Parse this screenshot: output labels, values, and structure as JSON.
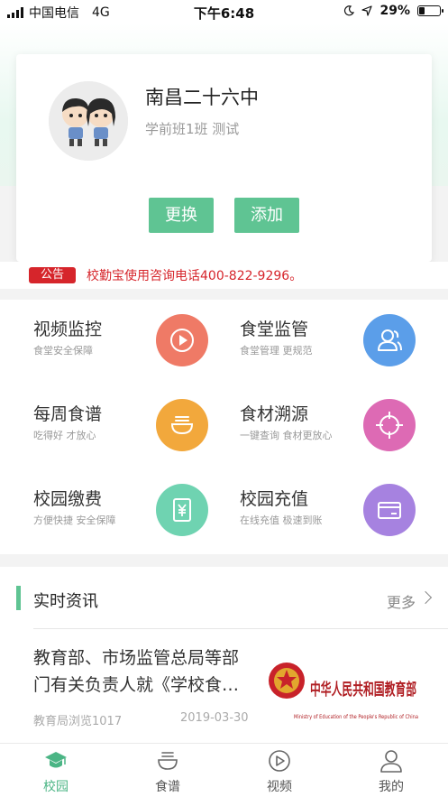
{
  "status_bar": {
    "carrier": "中国电信",
    "network": "4G",
    "time": "下午6:48",
    "battery": "29%",
    "battery_level": 0.29
  },
  "school_card": {
    "name": "南昌二十六中",
    "class_info": "学前班1班 测试",
    "change_label": "更换",
    "add_label": "添加"
  },
  "notice": {
    "tag": "公告",
    "text": "校勤宝使用咨询电话400-822-9296。"
  },
  "features": [
    {
      "title": "视频监控",
      "subtitle": "食堂安全保障",
      "icon": "play-icon",
      "color": "#ef7a66"
    },
    {
      "title": "食堂监管",
      "subtitle": "食堂管理 更规范",
      "icon": "people-icon",
      "color": "#5b9ee9"
    },
    {
      "title": "每周食谱",
      "subtitle": "吃得好 才放心",
      "icon": "bowl-icon",
      "color": "#f2a83c"
    },
    {
      "title": "食材溯源",
      "subtitle": "一键查询 食材更放心",
      "icon": "target-icon",
      "color": "#dd6ab4"
    },
    {
      "title": "校园缴费",
      "subtitle": "方便快捷 安全保障",
      "icon": "yen-icon",
      "color": "#6fd3b1"
    },
    {
      "title": "校园充值",
      "subtitle": "在线充值 极速到账",
      "icon": "card-icon",
      "color": "#a682e0"
    }
  ],
  "news": {
    "section_title": "实时资讯",
    "more_label": "更多",
    "article": {
      "title": "教育部、市场监管总局等部门有关负责人就《学校食…",
      "meta": "教育局浏览1017",
      "date": "2019-03-30",
      "image_text": "中华人民共和国教育部",
      "image_subtext": "Ministry of Education of the People's Republic of China"
    }
  },
  "tabbar": {
    "tabs": [
      {
        "label": "校园",
        "icon": "graduation-cap-icon",
        "active": true
      },
      {
        "label": "食谱",
        "icon": "bowl-icon",
        "active": false
      },
      {
        "label": "视频",
        "icon": "play-circle-icon",
        "active": false
      },
      {
        "label": "我的",
        "icon": "user-icon",
        "active": false
      }
    ]
  },
  "colors": {
    "accent": "#5fc493",
    "notice_red": "#d6252b",
    "tab_active": "#4bb585"
  }
}
